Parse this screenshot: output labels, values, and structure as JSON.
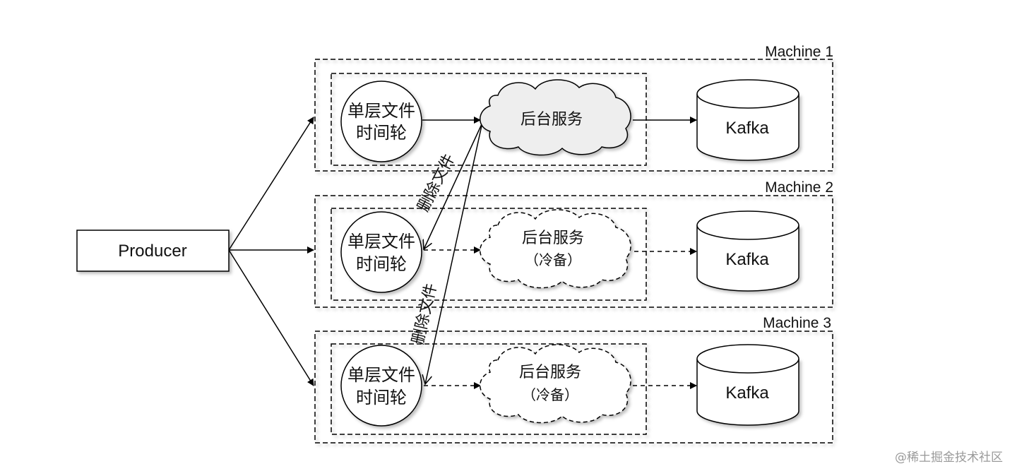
{
  "producer": {
    "label": "Producer"
  },
  "machines": [
    {
      "title": "Machine 1",
      "wheel": [
        "单层文件",
        "时间轮"
      ],
      "service": [
        "后台服务"
      ],
      "service_state": "active",
      "kafka": "Kafka"
    },
    {
      "title": "Machine 2",
      "wheel": [
        "单层文件",
        "时间轮"
      ],
      "service": [
        "后台服务",
        "（冷备）"
      ],
      "service_state": "standby",
      "kafka": "Kafka"
    },
    {
      "title": "Machine 3",
      "wheel": [
        "单层文件",
        "时间轮"
      ],
      "service": [
        "后台服务",
        "（冷备）"
      ],
      "service_state": "standby",
      "kafka": "Kafka"
    }
  ],
  "edges": {
    "delete_file_label": "删除文件"
  },
  "colors": {
    "line": "#000000",
    "active_cloud_fill": "#eeeeee",
    "standby_cloud_fill": "#ffffff"
  },
  "watermark": "@稀土掘金技术社区"
}
